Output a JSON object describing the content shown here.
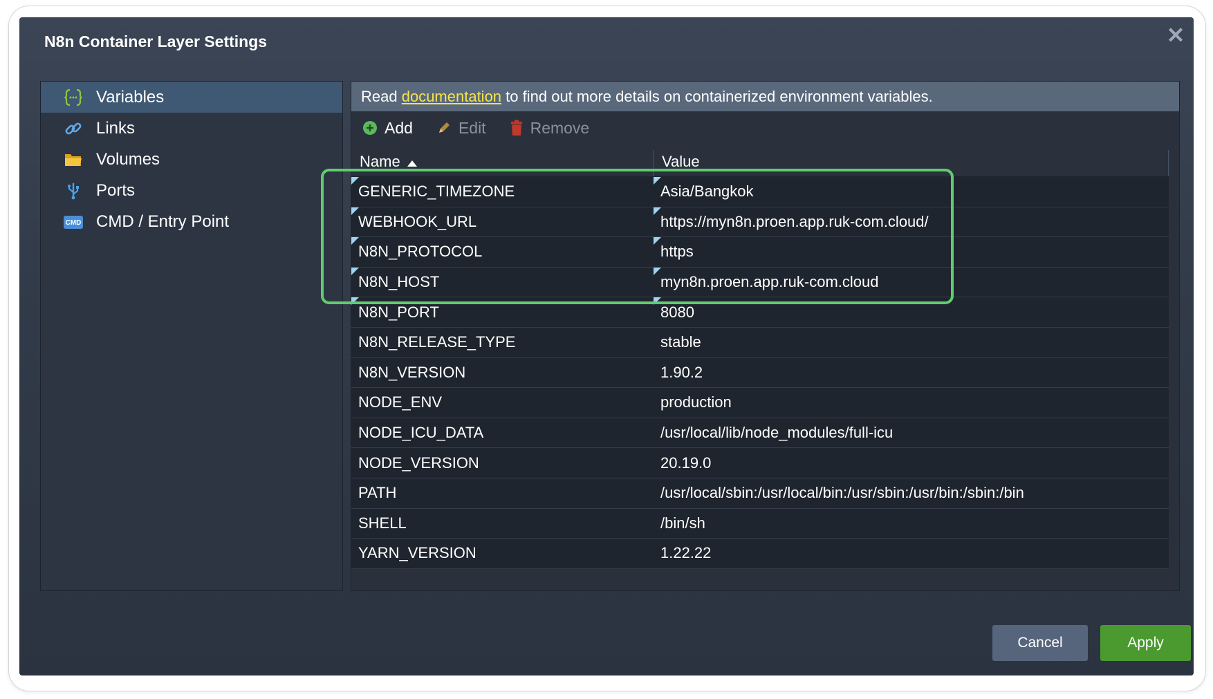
{
  "dialog": {
    "title": "N8n Container Layer Settings",
    "close_icon": "close-icon"
  },
  "sidebar": {
    "items": [
      {
        "label": "Variables",
        "icon": "variables-braces-icon",
        "active": true
      },
      {
        "label": "Links",
        "icon": "link-icon",
        "active": false
      },
      {
        "label": "Volumes",
        "icon": "folder-icon",
        "active": false
      },
      {
        "label": "Ports",
        "icon": "usb-port-icon",
        "active": false
      },
      {
        "label": "CMD / Entry Point",
        "icon": "cmd-icon",
        "active": false
      }
    ]
  },
  "info": {
    "prefix": "Read ",
    "link": "documentation",
    "suffix": " to find out more details on containerized environment variables."
  },
  "toolbar": {
    "add_label": "Add",
    "edit_label": "Edit",
    "remove_label": "Remove"
  },
  "table": {
    "columns": {
      "name": "Name",
      "value": "Value"
    },
    "sort": "Name ascending",
    "rows": [
      {
        "name": "GENERIC_TIMEZONE",
        "value": "Asia/Bangkok",
        "modified": true
      },
      {
        "name": "WEBHOOK_URL",
        "value": "https://myn8n.proen.app.ruk-com.cloud/",
        "modified": true
      },
      {
        "name": "N8N_PROTOCOL",
        "value": "https",
        "modified": true
      },
      {
        "name": "N8N_HOST",
        "value": "myn8n.proen.app.ruk-com.cloud",
        "modified": true
      },
      {
        "name": "N8N_PORT",
        "value": "8080",
        "modified": true
      },
      {
        "name": "N8N_RELEASE_TYPE",
        "value": "stable",
        "modified": false
      },
      {
        "name": "N8N_VERSION",
        "value": "1.90.2",
        "modified": false
      },
      {
        "name": "NODE_ENV",
        "value": "production",
        "modified": false
      },
      {
        "name": "NODE_ICU_DATA",
        "value": "/usr/local/lib/node_modules/full-icu",
        "modified": false
      },
      {
        "name": "NODE_VERSION",
        "value": "20.19.0",
        "modified": false
      },
      {
        "name": "PATH",
        "value": "/usr/local/sbin:/usr/local/bin:/usr/sbin:/usr/bin:/sbin:/bin",
        "modified": false
      },
      {
        "name": "SHELL",
        "value": "/bin/sh",
        "modified": false
      },
      {
        "name": "YARN_VERSION",
        "value": "1.22.22",
        "modified": false
      }
    ]
  },
  "footer": {
    "cancel_label": "Cancel",
    "apply_label": "Apply"
  },
  "colors": {
    "highlight": "#5fcd6e",
    "apply": "#4a9a2f",
    "active_nav": "#3f5873",
    "doc_link": "#f6e44a"
  }
}
